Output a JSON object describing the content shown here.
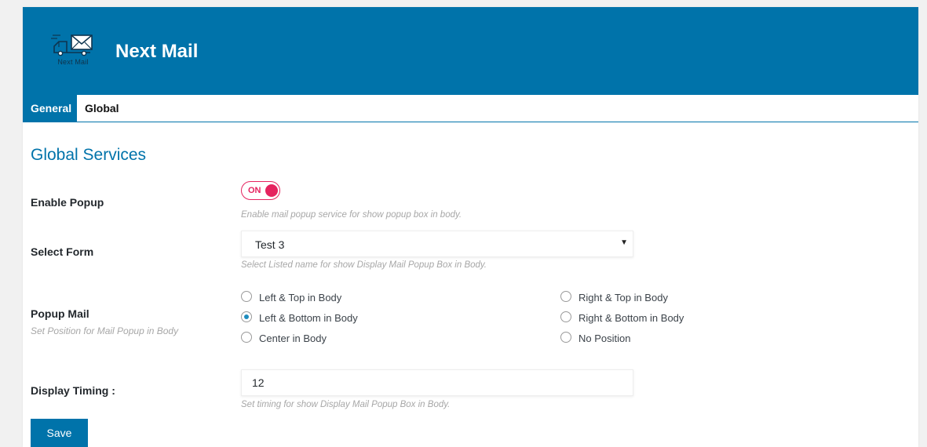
{
  "header": {
    "logo_text": "Next Mail",
    "title": "Next Mail"
  },
  "tabs": [
    {
      "label": "General",
      "active": true
    },
    {
      "label": "Global",
      "active": false
    }
  ],
  "section": {
    "title": "Global Services"
  },
  "enable_popup": {
    "label": "Enable Popup",
    "toggle_text": "ON",
    "enabled": true,
    "help": "Enable mail popup service for show popup box in body."
  },
  "select_form": {
    "label": "Select Form",
    "value": "Test 3",
    "help": "Select Listed name for show Display Mail Popup Box in Body."
  },
  "popup_mail": {
    "label": "Popup Mail",
    "sublabel": "Set Position for Mail Popup in Body",
    "options": [
      {
        "label": "Left & Top in Body",
        "checked": false
      },
      {
        "label": "Left & Bottom in Body",
        "checked": true
      },
      {
        "label": "Center in Body",
        "checked": false
      },
      {
        "label": "Right & Top in Body",
        "checked": false
      },
      {
        "label": "Right & Bottom in Body",
        "checked": false
      },
      {
        "label": "No Position",
        "checked": false
      }
    ]
  },
  "display_timing": {
    "label": "Display Timing :",
    "value": "12",
    "help": "Set timing for show Display Mail Popup Box in Body."
  },
  "save_label": "Save",
  "colors": {
    "primary": "#0073aa",
    "toggle": "#e5235f",
    "radio_checked": "#1e8cbe",
    "help_text": "#a7a7a7"
  },
  "icons": {
    "logo": "mail-truck-icon",
    "select_arrow": "caret-down-icon"
  }
}
